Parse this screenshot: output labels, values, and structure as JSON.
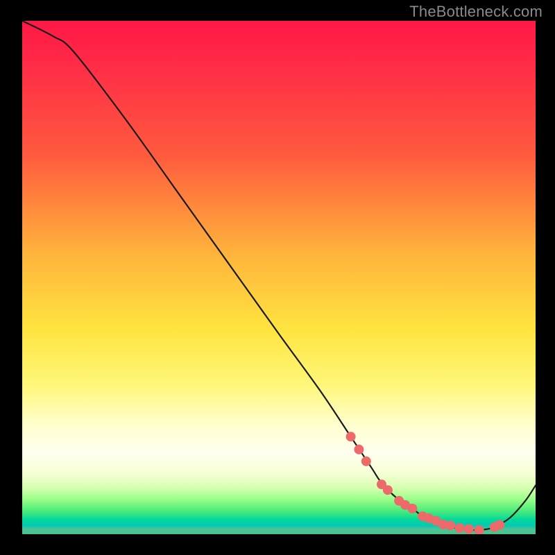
{
  "watermark": "TheBottleneck.com",
  "chart_data": {
    "type": "line",
    "title": "",
    "xlabel": "",
    "ylabel": "",
    "xlim": [
      0,
      100
    ],
    "ylim": [
      0,
      100
    ],
    "series": [
      {
        "name": "curve",
        "x": [
          0,
          6,
          10,
          20,
          30,
          40,
          50,
          58,
          64,
          68,
          70,
          73,
          76,
          78,
          80,
          82,
          84,
          86,
          88,
          90,
          92,
          95,
          98,
          100
        ],
        "values": [
          100,
          97,
          94,
          81,
          67,
          53,
          39,
          28,
          19,
          13,
          10,
          7,
          5,
          3.5,
          2.6,
          1.9,
          1.3,
          1.0,
          0.8,
          0.9,
          1.4,
          3.2,
          6.5,
          9.5
        ]
      }
    ],
    "highlight_points": {
      "name": "dots",
      "x": [
        64.0,
        65.6,
        67.0,
        70.0,
        71.2,
        73.4,
        74.6,
        76.0,
        78.0,
        79.2,
        80.6,
        82.0,
        83.4,
        85.2,
        87.0,
        89.0,
        92.0,
        93.0
      ],
      "values": [
        19.0,
        16.5,
        14.2,
        9.7,
        8.6,
        6.5,
        5.7,
        5.0,
        3.5,
        3.1,
        2.6,
        1.9,
        1.7,
        1.2,
        1.0,
        0.8,
        1.4,
        1.8
      ]
    },
    "gradient_bands": [
      {
        "y": 100,
        "color": "#ff1846"
      },
      {
        "y": 55,
        "color": "#ffb23c"
      },
      {
        "y": 30,
        "color": "#fff77a"
      },
      {
        "y": 12,
        "color": "#ffffef"
      },
      {
        "y": 3,
        "color": "#00d89e"
      }
    ]
  }
}
